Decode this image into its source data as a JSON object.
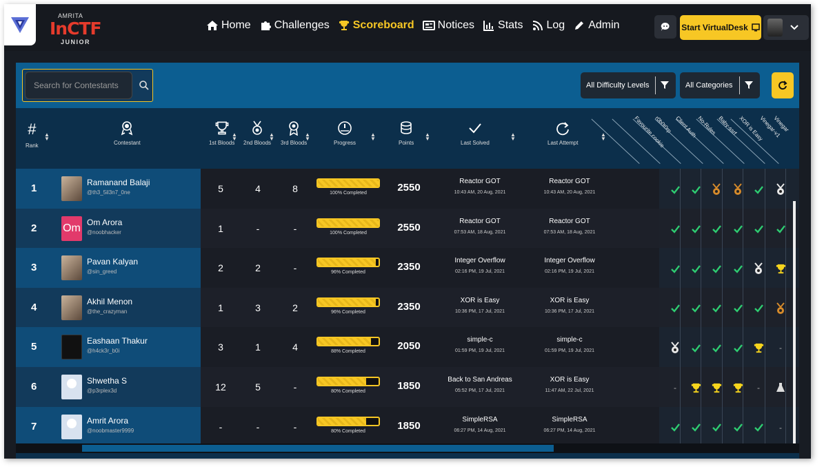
{
  "brand": {
    "top": "AMRITA",
    "main": "InCTF",
    "sub": "JUNIOR"
  },
  "nav": [
    {
      "label": "Home",
      "icon": "home-icon",
      "active": false
    },
    {
      "label": "Challenges",
      "icon": "puzzle-icon",
      "active": false
    },
    {
      "label": "Scoreboard",
      "icon": "trophy-icon",
      "active": true
    },
    {
      "label": "Notices",
      "icon": "newspaper-icon",
      "active": false
    },
    {
      "label": "Stats",
      "icon": "bar-chart-icon",
      "active": false
    },
    {
      "label": "Log",
      "icon": "rss-icon",
      "active": false
    },
    {
      "label": "Admin",
      "icon": "pencil-icon",
      "active": false
    }
  ],
  "topright": {
    "virtualdesk_label": "Start VirtualDesk"
  },
  "search": {
    "placeholder": "Search for Contestants"
  },
  "filters": {
    "difficulty": "All Difficulty Levels",
    "category": "All Categories"
  },
  "headers": {
    "rank": "Rank",
    "contestant": "Contestant",
    "first": "1st Bloods",
    "second": "2nd Bloods",
    "third": "3rd Bloods",
    "progress": "Progress",
    "points": "Points",
    "last_solved": "Last Solved",
    "last_attempt": "Last Attempt"
  },
  "challenges": [
    "Favourite cookie",
    "r0b0t0rp",
    "Client Auth",
    "No-Rules",
    "Baby-ssrf",
    "XOR is Easy",
    "Vinegar-v1",
    "Vinegar"
  ],
  "rows": [
    {
      "rank": "1",
      "name": "Ramanand Balaji",
      "handle": "@th3_5il3n7_0ne",
      "avatar": "photo",
      "initials": "",
      "b1": "5",
      "b2": "4",
      "b3": "8",
      "progress": 1.0,
      "progress_text": "100% Completed",
      "points": "2550",
      "solved": "Reactor GOT",
      "solved_time": "10:43 AM, 20 Aug, 2021",
      "attempt": "Reactor GOT",
      "attempt_time": "10:43 AM, 20 Aug, 2021",
      "cells": [
        "check",
        "check",
        "bronze",
        "bronze",
        "check",
        "silver"
      ]
    },
    {
      "rank": "2",
      "name": "Om Arora",
      "handle": "@noobhacker",
      "avatar": "initials",
      "initials": "Om",
      "b1": "1",
      "b2": "-",
      "b3": "-",
      "progress": 1.0,
      "progress_text": "100% Completed",
      "points": "2550",
      "solved": "Reactor GOT",
      "solved_time": "07:53 AM, 18 Aug, 2021",
      "attempt": "Reactor GOT",
      "attempt_time": "07:53 AM, 18 Aug, 2021",
      "cells": [
        "check",
        "check",
        "check",
        "check",
        "check",
        "check"
      ]
    },
    {
      "rank": "3",
      "name": "Pavan Kalyan",
      "handle": "@sin_greed",
      "avatar": "photo",
      "initials": "",
      "b1": "2",
      "b2": "2",
      "b3": "-",
      "progress": 0.96,
      "progress_text": "96% Completed",
      "points": "2350",
      "solved": "Integer Overflow",
      "solved_time": "02:16 PM, 19 Jul, 2021",
      "attempt": "Integer Overflow",
      "attempt_time": "02:16 PM, 19 Jul, 2021",
      "cells": [
        "check",
        "check",
        "check",
        "check",
        "silver",
        "gold"
      ]
    },
    {
      "rank": "4",
      "name": "Akhil Menon",
      "handle": "@the_crazyman",
      "avatar": "photo",
      "initials": "",
      "b1": "1",
      "b2": "3",
      "b3": "2",
      "progress": 0.96,
      "progress_text": "96% Completed",
      "points": "2350",
      "solved": "XOR is Easy",
      "solved_time": "10:36 PM, 17 Jul, 2021",
      "attempt": "XOR is Easy",
      "attempt_time": "10:36 PM, 17 Jul, 2021",
      "cells": [
        "check",
        "check",
        "check",
        "check",
        "check",
        "bronze"
      ]
    },
    {
      "rank": "5",
      "name": "Eashaan Thakur",
      "handle": "@h4ck3r_b0i",
      "avatar": "dark",
      "initials": "",
      "b1": "3",
      "b2": "1",
      "b3": "4",
      "progress": 0.88,
      "progress_text": "88% Completed",
      "points": "2050",
      "solved": "simple-c",
      "solved_time": "01:59 PM, 19 Jul, 2021",
      "attempt": "simple-c",
      "attempt_time": "01:59 PM, 19 Jul, 2021",
      "cells": [
        "silver",
        "check",
        "check",
        "check",
        "gold",
        "dash"
      ]
    },
    {
      "rank": "6",
      "name": "Shwetha S",
      "handle": "@p3rplex3d",
      "avatar": "blank",
      "initials": "",
      "b1": "12",
      "b2": "5",
      "b3": "-",
      "progress": 0.8,
      "progress_text": "80% Completed",
      "points": "1850",
      "solved": "Back to San Andreas",
      "solved_time": "05:52 PM, 17 Jul, 2021",
      "attempt": "XOR is Easy",
      "attempt_time": "11:47 AM, 22 Jul, 2021",
      "cells": [
        "dash",
        "gold",
        "gold",
        "gold",
        "dash",
        "flask"
      ]
    },
    {
      "rank": "7",
      "name": "Amrit Arora",
      "handle": "@noobmaster9999",
      "avatar": "blank",
      "initials": "",
      "b1": "-",
      "b2": "-",
      "b3": "-",
      "progress": 0.8,
      "progress_text": "80% Completed",
      "points": "1850",
      "solved": "SimpleRSA",
      "solved_time": "06:27 PM, 14 Aug, 2021",
      "attempt": "SimpleRSA",
      "attempt_time": "06:27 PM, 14 Aug, 2021",
      "cells": [
        "check",
        "check",
        "check",
        "check",
        "check",
        "dash"
      ]
    }
  ],
  "colors": {
    "accent": "#f7c724",
    "check": "#2ecc71",
    "gold": "#f7d51d",
    "silver": "#e8e8e8",
    "bronze": "#d58a2b"
  }
}
